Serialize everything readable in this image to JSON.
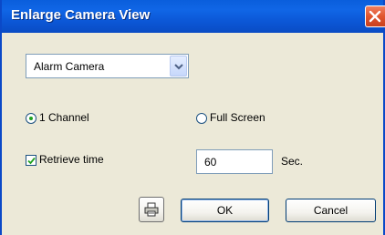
{
  "window": {
    "title": "Enlarge Camera View"
  },
  "camera_select": {
    "value": "Alarm Camera"
  },
  "view_mode": {
    "options": [
      {
        "label": "1 Channel",
        "selected": true
      },
      {
        "label": "Full Screen",
        "selected": false
      }
    ]
  },
  "retrieve_time": {
    "label": "Retrieve time",
    "checked": true,
    "value": "60",
    "unit": "Sec."
  },
  "buttons": {
    "ok_label": "OK",
    "cancel_label": "Cancel",
    "print_icon": "printer-icon"
  },
  "colors": {
    "titlebar": "#0a5edc",
    "close": "#e0552e",
    "dialog_bg": "#ece9d8",
    "radio_dot": "#21a121"
  }
}
